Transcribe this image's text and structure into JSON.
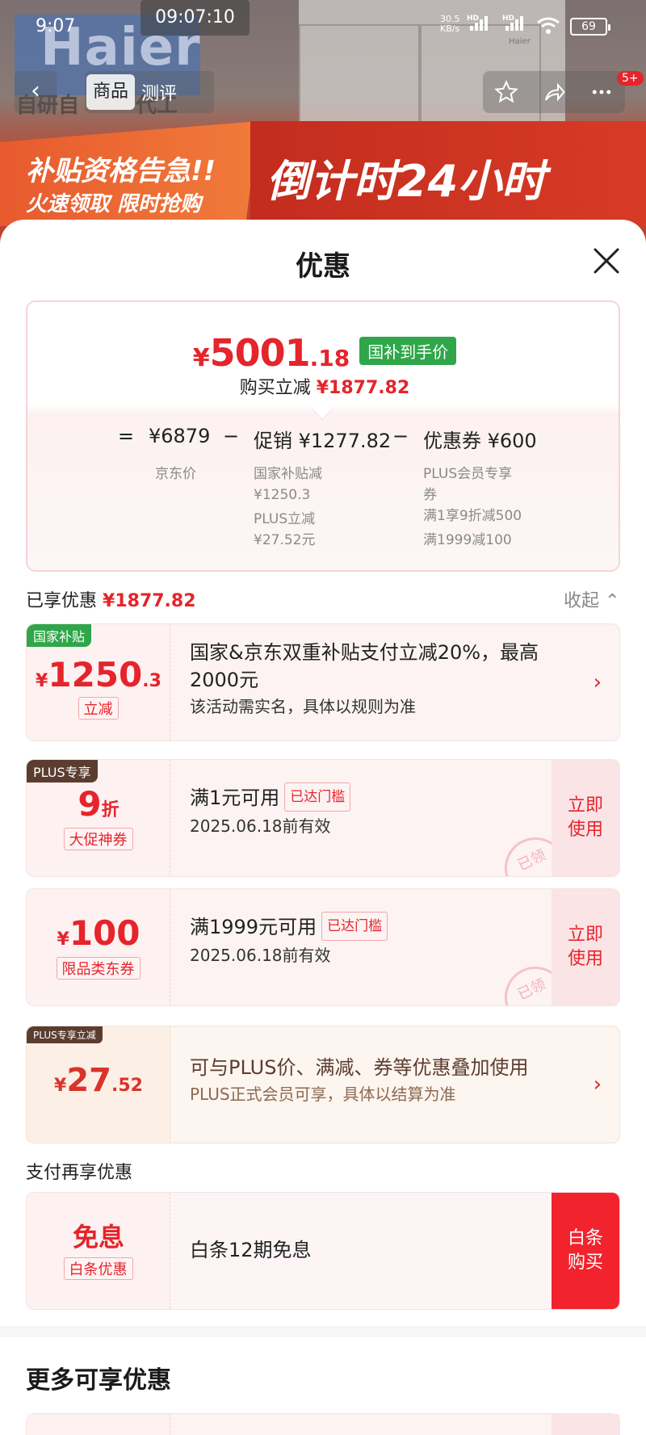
{
  "status_bar": {
    "time": "9:07",
    "clock": "09:07:10",
    "net_rate": "30.5",
    "net_unit": "KB/s",
    "hd1": "HD",
    "hd2": "HD",
    "battery": "69"
  },
  "banner": {
    "brand": "Haier",
    "brand_small": "Haier",
    "tagline": "自研自",
    "tagline_tail": "代工",
    "promo_line1": "补贴资格告急!!",
    "promo_line2": "火速领取 限时抢购",
    "promo_countdown": "倒计时24小时"
  },
  "nav": {
    "tabs": [
      "商品",
      "测评"
    ],
    "badge": "5+"
  },
  "sheet": {
    "title": "优惠"
  },
  "summary": {
    "currency": "¥",
    "price_int": "5001",
    "price_dec": ".18",
    "price_tag": "国补到手价",
    "reduce_label": "购买立减",
    "reduce_value": "¥1877.82",
    "eq": "=",
    "jd_price": "¥6879",
    "jd_label": "京东价",
    "minus1": "−",
    "promo_label": "促销 ¥1277.82",
    "promo_sub1a": "国家补贴减",
    "promo_sub1b": "¥1250.3",
    "promo_sub2a": "PLUS立减",
    "promo_sub2b": "¥27.52元",
    "minus2": "−",
    "coupon_label": "优惠券 ¥600",
    "coupon_sub1a": "PLUS会员专享",
    "coupon_sub1b": "券",
    "coupon_sub2": "满1享9折减500",
    "coupon_sub3": "满1999减100"
  },
  "enjoyed": {
    "label": "已享优惠",
    "value": "¥1877.82",
    "collapse": "收起"
  },
  "coupons": [
    {
      "ribbon": "国家补贴",
      "currency": "¥",
      "amount": "1250",
      "amount_dec": ".3",
      "chip": "立减",
      "title": "国家&京东双重补贴支付立减20%，最高",
      "title2": "2000元",
      "desc": "该活动需实名，具体以规则为准"
    },
    {
      "ribbon": "PLUS专享",
      "amount": "9",
      "amount_unit": "折",
      "chip": "大促神券",
      "title": "满1元可用",
      "threshold": "已达门槛",
      "desc": "2025.06.18前有效",
      "button": "立即使用",
      "stamp": "已领"
    },
    {
      "currency": "¥",
      "amount": "100",
      "chip": "限品类东券",
      "title": "满1999元可用",
      "threshold": "已达门槛",
      "desc": "2025.06.18前有效",
      "button": "立即使用",
      "stamp": "已领"
    },
    {
      "ribbon": "PLUS专享立减",
      "currency": "¥",
      "amount": "27",
      "amount_dec": ".52",
      "title": "可与PLUS价、满减、券等优惠叠加使用",
      "desc": "PLUS正式会员可享，具体以结算为准"
    }
  ],
  "pay_section": {
    "label": "支付再享优惠",
    "amount": "免息",
    "chip": "白条优惠",
    "title": "白条12期免息",
    "button": "白条购买"
  },
  "more": {
    "title": "更多可享优惠"
  },
  "colors": {
    "accent_red": "#e5242b",
    "green_tag": "#2fa64a",
    "plus_brown": "#5b3d30"
  }
}
